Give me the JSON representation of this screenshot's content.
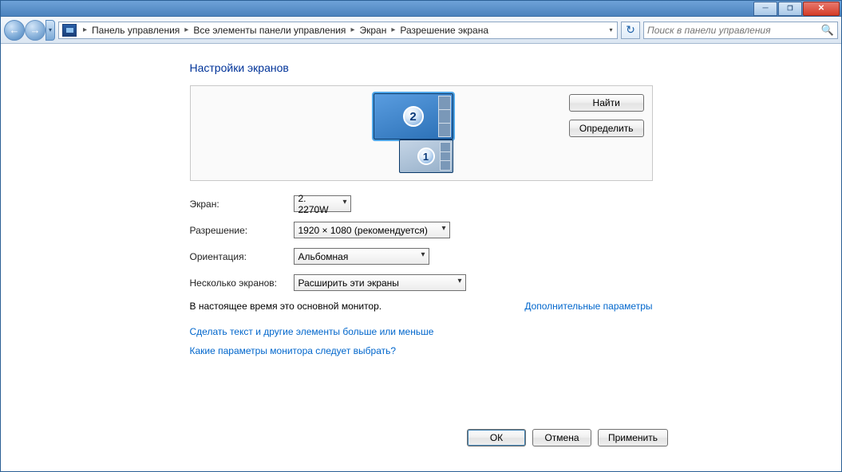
{
  "titlebar": {},
  "nav": {
    "crumbs": [
      "Панель управления",
      "Все элементы панели управления",
      "Экран",
      "Разрешение экрана"
    ],
    "search_placeholder": "Поиск в панели управления"
  },
  "page": {
    "title": "Настройки экранов",
    "find_btn": "Найти",
    "identify_btn": "Определить",
    "monitors": [
      "2",
      "1"
    ]
  },
  "fields": {
    "screen_label": "Экран:",
    "screen_value": "2. 2270W",
    "resolution_label": "Разрешение:",
    "resolution_value": "1920 × 1080 (рекомендуется)",
    "orientation_label": "Ориентация:",
    "orientation_value": "Альбомная",
    "multi_label": "Несколько экранов:",
    "multi_value": "Расширить эти экраны"
  },
  "status": {
    "primary_note": "В настоящее время это основной монитор.",
    "advanced_link": "Дополнительные параметры"
  },
  "links": {
    "text_size": "Сделать текст и другие элементы больше или меньше",
    "which_settings": "Какие параметры монитора следует выбрать?"
  },
  "buttons": {
    "ok": "ОК",
    "cancel": "Отмена",
    "apply": "Применить"
  }
}
